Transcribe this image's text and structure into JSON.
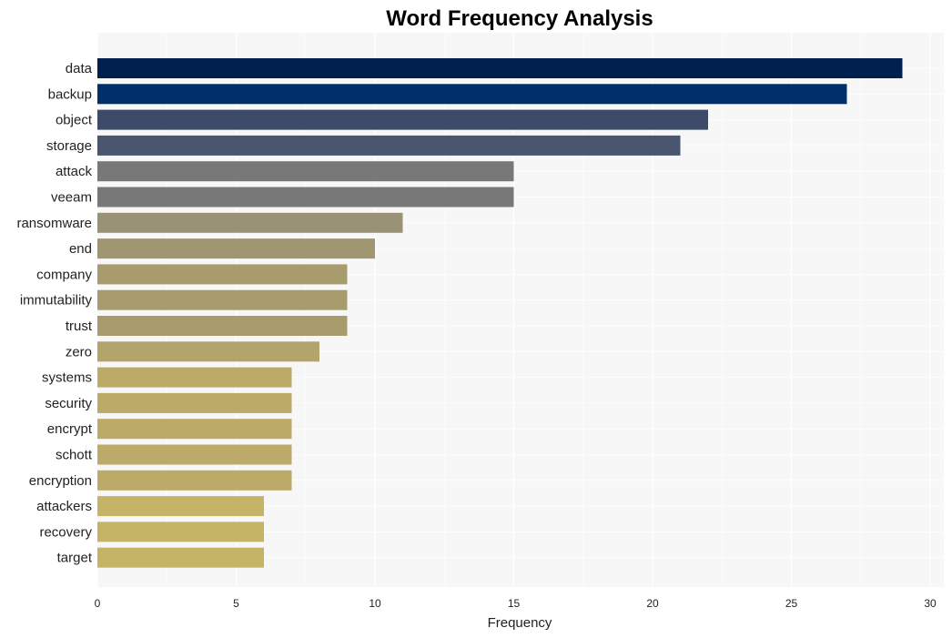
{
  "chart_data": {
    "type": "bar",
    "orientation": "horizontal",
    "title": "Word Frequency Analysis",
    "xlabel": "Frequency",
    "ylabel": "",
    "xlim": [
      0,
      30.5
    ],
    "xticks": [
      0,
      5,
      10,
      15,
      20,
      25,
      30
    ],
    "grid": true,
    "categories": [
      "data",
      "backup",
      "object",
      "storage",
      "attack",
      "veeam",
      "ransomware",
      "end",
      "company",
      "immutability",
      "trust",
      "zero",
      "systems",
      "security",
      "encrypt",
      "schott",
      "encryption",
      "attackers",
      "recovery",
      "target"
    ],
    "values": [
      29,
      27,
      22,
      21,
      15,
      15,
      11,
      10,
      9,
      9,
      9,
      8,
      7,
      7,
      7,
      7,
      7,
      6,
      6,
      6
    ],
    "colors": [
      "#00214e",
      "#002f6c",
      "#3e4a6a",
      "#4a5570",
      "#787878",
      "#787878",
      "#9a9276",
      "#a09672",
      "#a89c6e",
      "#a89c6e",
      "#a89c6e",
      "#b2a46a",
      "#bcaa68",
      "#bcaa68",
      "#bcaa68",
      "#bcaa68",
      "#bcaa68",
      "#c6b466",
      "#c6b466",
      "#c6b466"
    ]
  }
}
